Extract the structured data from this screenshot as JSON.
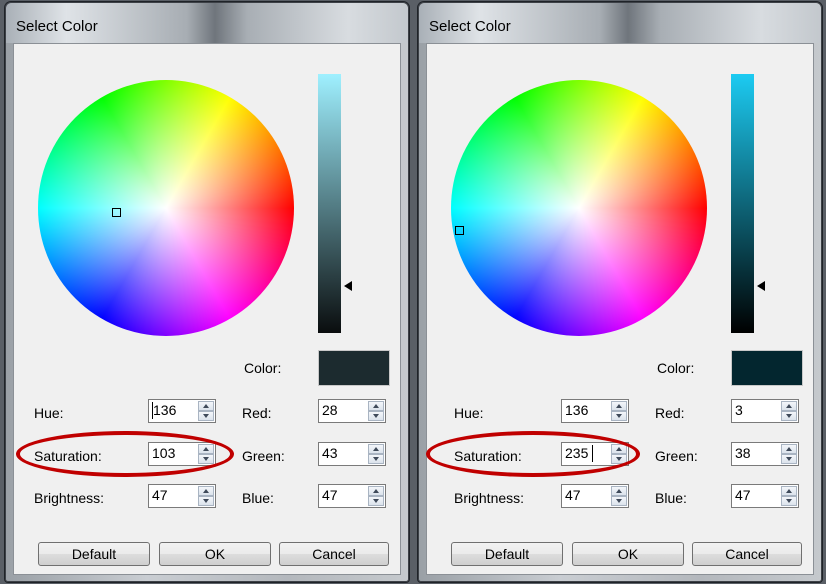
{
  "dialogs": [
    {
      "title": "Select Color",
      "labels": {
        "color": "Color:",
        "hue": "Hue:",
        "saturation": "Saturation:",
        "brightness": "Brightness:",
        "red": "Red:",
        "green": "Green:",
        "blue": "Blue:"
      },
      "values": {
        "hue": "136",
        "saturation": "103",
        "brightness": "47",
        "red": "28",
        "green": "43",
        "blue": "47"
      },
      "buttons": {
        "default": "Default",
        "ok": "OK",
        "cancel": "Cancel"
      },
      "swatch_color": "#1c2b2f",
      "focused_field": "hue"
    },
    {
      "title": "Select Color",
      "labels": {
        "color": "Color:",
        "hue": "Hue:",
        "saturation": "Saturation:",
        "brightness": "Brightness:",
        "red": "Red:",
        "green": "Green:",
        "blue": "Blue:"
      },
      "values": {
        "hue": "136",
        "saturation": "235",
        "brightness": "47",
        "red": "3",
        "green": "38",
        "blue": "47"
      },
      "buttons": {
        "default": "Default",
        "ok": "OK",
        "cancel": "Cancel"
      },
      "swatch_color": "#03262f",
      "focused_field": "saturation"
    }
  ],
  "annotation_color": "#c00000"
}
